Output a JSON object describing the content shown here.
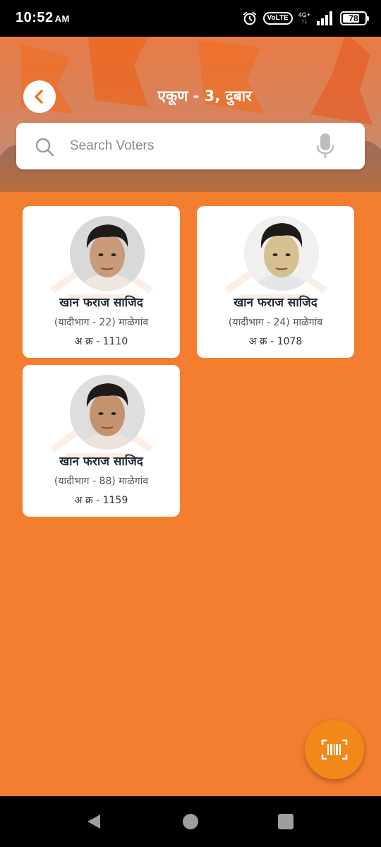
{
  "status_bar": {
    "time": "10:52",
    "ampm": "AM",
    "volte": "VoLTE",
    "network": "4G+",
    "battery": "78",
    "battery_fraction": 0.78
  },
  "header": {
    "title": "एकूण - 3, दुबार"
  },
  "search": {
    "placeholder": "Search Voters",
    "value": ""
  },
  "voters": [
    {
      "name": "खान फराज साजिद",
      "part": "(यादीभाग - 22) माळेगांव",
      "serial": "अ क्र - 1110"
    },
    {
      "name": "खान फराज साजिद",
      "part": "(यादीभाग - 24) माळेगांव",
      "serial": "अ क्र - 1078"
    },
    {
      "name": "खान फराज साजिद",
      "part": "(यादीभाग - 88) माळेगांव",
      "serial": "अ क्र - 1159"
    }
  ],
  "colors": {
    "background": "#f47e30",
    "accent": "#f2881a",
    "back_arrow": "#f07a1a",
    "name_text": "#1f2b3a"
  },
  "icons": [
    "back-arrow-icon",
    "search-icon",
    "mic-icon",
    "barcode-scan-icon",
    "alarm-icon",
    "signal-icon",
    "battery-icon"
  ]
}
